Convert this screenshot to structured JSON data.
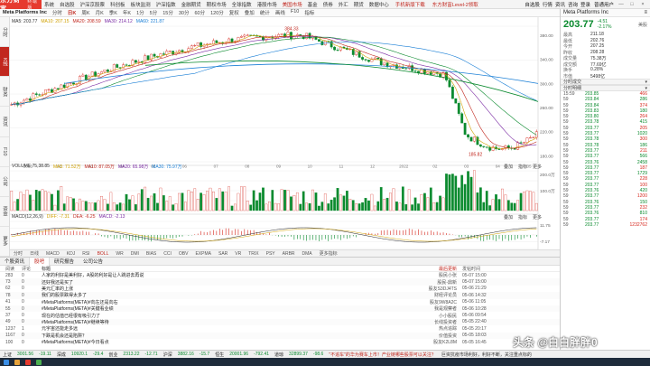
{
  "app": {
    "logo": "东方财富",
    "logo_sub": "终端版",
    "menu": [
      "系统",
      "自选股",
      "沪深京股票",
      "科创板",
      "板块监测",
      "沪深指数",
      "金融期货",
      "期权市场",
      "全球指数",
      "港股市场",
      "美国市场",
      "基金",
      "债券",
      "外汇",
      "期货",
      "数据中心"
    ],
    "menu_highlight": "美国市场",
    "promo1": "手机新版下载",
    "promo2": "东方财富Level-2领取",
    "right_items": [
      "自选股",
      "行情",
      "资讯",
      "咨询",
      "登录"
    ],
    "user": "普通用户"
  },
  "toolbar": {
    "items": [
      "分时",
      "日K",
      "周K",
      "月K",
      "季K",
      "年K",
      "1分",
      "5分",
      "15分",
      "30分",
      "60分",
      "120分",
      "复权",
      "叠加",
      "统计",
      "画线",
      "F10",
      "指标"
    ],
    "active": "日K"
  },
  "left_tabs": [
    "分时",
    "K线",
    "财务",
    "资讯",
    "F10",
    "公司",
    "资金",
    "更多"
  ],
  "left_tab_active": "K线",
  "chart": {
    "title": "Meta Platforms Inc",
    "ma_line": [
      "MA5: 203.77",
      "MA10: 207.15",
      "MA20: 208.59",
      "MA30: 214.12",
      "MA60: 221.87"
    ],
    "vol_line": [
      "VOLUME 75,38.85",
      "MA5: 71.52万",
      "MA10: 87.05万",
      "MA20: 65.98万",
      "MA30: 75.97万"
    ],
    "macd_line": [
      "MACD(12,26,9)",
      "DIFF: -7.31",
      "DEA: -6.25",
      "MACD: -2.13"
    ],
    "annotation_high": "384.33",
    "annotation_low": "185.82",
    "price_axis": [
      "380.00",
      "340.00",
      "300.00",
      "260.00",
      "220.00",
      "180.00"
    ],
    "vol_axis": [
      "200.0万",
      "100.0万"
    ],
    "macd_axis": [
      "11.75",
      "-7.17"
    ],
    "years": [
      "2021",
      "02",
      "03",
      "04",
      "05",
      "06",
      "07",
      "08",
      "09",
      "10",
      "11",
      "12",
      "2022",
      "02",
      "03",
      "04",
      "05"
    ],
    "sub_controls": [
      "叠加",
      "指标",
      "更多"
    ],
    "bottom_tabs": [
      "分时",
      "日线",
      "MACD",
      "KDJ",
      "RSI",
      "BOLL",
      "WR",
      "DMI",
      "BIAS",
      "CCI",
      "OBV",
      "EXPMA",
      "SAR",
      "VR",
      "TRIX",
      "PSY",
      "ARBR",
      "DMA",
      "更多指标"
    ],
    "bottom_active": "BOLL"
  },
  "news": {
    "tabs": [
      "个股资讯",
      "股吧",
      "研究报告",
      "公司公告"
    ],
    "active_tab": "股吧",
    "headers": {
      "read": "阅读",
      "comments": "评论",
      "title": "标题",
      "author": "最后更新",
      "time": "发帖时间"
    },
    "rows": [
      {
        "read": "283",
        "cmt": "0",
        "title": "人家的利好是美利好，A股的利好是让人跳进去再说",
        "author": "股民小张",
        "time": "05-07 15:00"
      },
      {
        "read": "73",
        "cmt": "0",
        "title": "还好我还是买了",
        "author": "股民-鼎新",
        "time": "05-07 15:00"
      },
      {
        "read": "62",
        "cmt": "0",
        "title": "美元汇率的上涨",
        "author": "股友S3DJ4TS",
        "time": "05-06 21:29"
      },
      {
        "read": "78",
        "cmt": "0",
        "title": "我们的股票跌得太多了",
        "author": "财经评论员",
        "time": "05-06 14:32"
      },
      {
        "read": "41",
        "cmt": "0",
        "title": "#MetaPlatforms(META)#向左还是向右",
        "author": "股友9W8A2C",
        "time": "05-06 11:05"
      },
      {
        "read": "55",
        "cmt": "0",
        "title": "#MetaPlatforms(META)#关键看业绩",
        "author": "我是观察者",
        "time": "05-06 10:28"
      },
      {
        "read": "37",
        "cmt": "0",
        "title": "现在的估值已经很有吸引力了",
        "author": "小小股民",
        "time": "05-06 09:54"
      },
      {
        "read": "49",
        "cmt": "0",
        "title": "#MetaPlatforms(META)#继续等待",
        "author": "长线投资者",
        "time": "05-05 22:40"
      },
      {
        "read": "1237",
        "cmt": "1",
        "title": "元宇宙还能走多远",
        "author": "热点追踪",
        "time": "05-05 20:17"
      },
      {
        "read": "1167",
        "cmt": "0",
        "title": "下跌是机会还是陷阱？",
        "author": "价值投资",
        "time": "05-05 18:03"
      },
      {
        "read": "100",
        "cmt": "0",
        "title": "#MetaPlatforms(META)#今日看点",
        "author": "股友K2L8M",
        "time": "05-05 16:45"
      }
    ]
  },
  "right_panel": {
    "title": "Meta Platforms Inc",
    "price": "203.77",
    "change": "-4.51",
    "change_pct": "-2.17%",
    "market": "美股",
    "kv": [
      {
        "k": "最高",
        "v": "211.18"
      },
      {
        "k": "最低",
        "v": "202.76"
      },
      {
        "k": "今开",
        "v": "207.25"
      },
      {
        "k": "昨收",
        "v": "208.28"
      },
      {
        "k": "成交量",
        "v": "75.38万"
      },
      {
        "k": "成交额",
        "v": "77.69亿"
      },
      {
        "k": "换手",
        "v": "0.28%"
      },
      {
        "k": "市值",
        "v": "5498亿"
      }
    ],
    "section1": "分时成交",
    "section2": "分时明细",
    "trades": [
      {
        "t": "15:59",
        "p": "203.85",
        "v": "466",
        "side": "b"
      },
      {
        "t": "59",
        "p": "203.84",
        "v": "286",
        "side": "s"
      },
      {
        "t": "59",
        "p": "203.84",
        "v": "374",
        "side": "b"
      },
      {
        "t": "59",
        "p": "203.83",
        "v": "180",
        "side": "s"
      },
      {
        "t": "59",
        "p": "203.80",
        "v": "264",
        "side": "b"
      },
      {
        "t": "59",
        "p": "203.78",
        "v": "415",
        "side": "s"
      },
      {
        "t": "59",
        "p": "203.77",
        "v": "205",
        "side": "b"
      },
      {
        "t": "59",
        "p": "203.77",
        "v": "1020",
        "side": "s"
      },
      {
        "t": "59",
        "p": "203.78",
        "v": "300",
        "side": "b"
      },
      {
        "t": "59",
        "p": "203.78",
        "v": "186",
        "side": "s"
      },
      {
        "t": "59",
        "p": "203.77",
        "v": "211",
        "side": "b"
      },
      {
        "t": "59",
        "p": "203.77",
        "v": "566",
        "side": "s"
      },
      {
        "t": "59",
        "p": "203.76",
        "v": "2458",
        "side": "s"
      },
      {
        "t": "59",
        "p": "203.77",
        "v": "187",
        "side": "b"
      },
      {
        "t": "59",
        "p": "203.77",
        "v": "1729",
        "side": "s"
      },
      {
        "t": "59",
        "p": "203.77",
        "v": "228",
        "side": "b"
      },
      {
        "t": "59",
        "p": "203.77",
        "v": "100",
        "side": "b"
      },
      {
        "t": "59",
        "p": "203.76",
        "v": "420",
        "side": "s"
      },
      {
        "t": "59",
        "p": "203.77",
        "v": "1200",
        "side": "b"
      },
      {
        "t": "59",
        "p": "203.76",
        "v": "150",
        "side": "s"
      },
      {
        "t": "59",
        "p": "203.77",
        "v": "232",
        "side": "b"
      },
      {
        "t": "59",
        "p": "203.76",
        "v": "810",
        "side": "s"
      },
      {
        "t": "59",
        "p": "203.77",
        "v": "174",
        "side": "b"
      },
      {
        "t": "59",
        "p": "203.77",
        "v": "1232762",
        "side": "b"
      }
    ]
  },
  "status": {
    "items": [
      {
        "label": "上证",
        "val": "3001.56",
        "chg": "-19.11",
        "dir": "down"
      },
      {
        "label": "深成",
        "val": "10920.1",
        "chg": "-29.4",
        "dir": "down"
      },
      {
        "label": "创业",
        "val": "2313.22",
        "chg": "-12.71",
        "dir": "down"
      },
      {
        "label": "沪深",
        "val": "3882.16",
        "chg": "-15.7",
        "dir": "down"
      },
      {
        "label": "恒生",
        "val": "20001.96",
        "chg": "-792.41",
        "dir": "down"
      },
      {
        "label": "道琼",
        "val": "32899.37",
        "chg": "-98.6",
        "dir": "down"
      }
    ],
    "ticker": "\"不追车\"的华为赛车上市！产业链哪些股票可以关注？",
    "news2": "巨资抗疫市场利好，利好不断，关注重点标的"
  },
  "watermark": "头条 @白白胖胖0"
}
